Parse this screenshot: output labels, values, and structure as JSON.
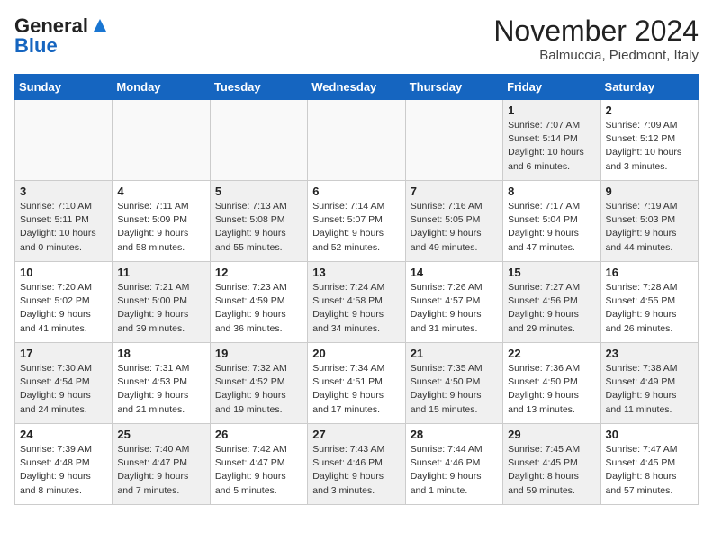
{
  "header": {
    "logo_general": "General",
    "logo_blue": "Blue",
    "month_year": "November 2024",
    "location": "Balmuccia, Piedmont, Italy"
  },
  "days_of_week": [
    "Sunday",
    "Monday",
    "Tuesday",
    "Wednesday",
    "Thursday",
    "Friday",
    "Saturday"
  ],
  "weeks": [
    [
      {
        "day": "",
        "info": "",
        "empty": true
      },
      {
        "day": "",
        "info": "",
        "empty": true
      },
      {
        "day": "",
        "info": "",
        "empty": true
      },
      {
        "day": "",
        "info": "",
        "empty": true
      },
      {
        "day": "",
        "info": "",
        "empty": true
      },
      {
        "day": "1",
        "info": "Sunrise: 7:07 AM\nSunset: 5:14 PM\nDaylight: 10 hours\nand 6 minutes.",
        "shaded": true
      },
      {
        "day": "2",
        "info": "Sunrise: 7:09 AM\nSunset: 5:12 PM\nDaylight: 10 hours\nand 3 minutes.",
        "shaded": false
      }
    ],
    [
      {
        "day": "3",
        "info": "Sunrise: 7:10 AM\nSunset: 5:11 PM\nDaylight: 10 hours\nand 0 minutes.",
        "shaded": true
      },
      {
        "day": "4",
        "info": "Sunrise: 7:11 AM\nSunset: 5:09 PM\nDaylight: 9 hours\nand 58 minutes.",
        "shaded": false
      },
      {
        "day": "5",
        "info": "Sunrise: 7:13 AM\nSunset: 5:08 PM\nDaylight: 9 hours\nand 55 minutes.",
        "shaded": true
      },
      {
        "day": "6",
        "info": "Sunrise: 7:14 AM\nSunset: 5:07 PM\nDaylight: 9 hours\nand 52 minutes.",
        "shaded": false
      },
      {
        "day": "7",
        "info": "Sunrise: 7:16 AM\nSunset: 5:05 PM\nDaylight: 9 hours\nand 49 minutes.",
        "shaded": true
      },
      {
        "day": "8",
        "info": "Sunrise: 7:17 AM\nSunset: 5:04 PM\nDaylight: 9 hours\nand 47 minutes.",
        "shaded": false
      },
      {
        "day": "9",
        "info": "Sunrise: 7:19 AM\nSunset: 5:03 PM\nDaylight: 9 hours\nand 44 minutes.",
        "shaded": true
      }
    ],
    [
      {
        "day": "10",
        "info": "Sunrise: 7:20 AM\nSunset: 5:02 PM\nDaylight: 9 hours\nand 41 minutes.",
        "shaded": false
      },
      {
        "day": "11",
        "info": "Sunrise: 7:21 AM\nSunset: 5:00 PM\nDaylight: 9 hours\nand 39 minutes.",
        "shaded": true
      },
      {
        "day": "12",
        "info": "Sunrise: 7:23 AM\nSunset: 4:59 PM\nDaylight: 9 hours\nand 36 minutes.",
        "shaded": false
      },
      {
        "day": "13",
        "info": "Sunrise: 7:24 AM\nSunset: 4:58 PM\nDaylight: 9 hours\nand 34 minutes.",
        "shaded": true
      },
      {
        "day": "14",
        "info": "Sunrise: 7:26 AM\nSunset: 4:57 PM\nDaylight: 9 hours\nand 31 minutes.",
        "shaded": false
      },
      {
        "day": "15",
        "info": "Sunrise: 7:27 AM\nSunset: 4:56 PM\nDaylight: 9 hours\nand 29 minutes.",
        "shaded": true
      },
      {
        "day": "16",
        "info": "Sunrise: 7:28 AM\nSunset: 4:55 PM\nDaylight: 9 hours\nand 26 minutes.",
        "shaded": false
      }
    ],
    [
      {
        "day": "17",
        "info": "Sunrise: 7:30 AM\nSunset: 4:54 PM\nDaylight: 9 hours\nand 24 minutes.",
        "shaded": true
      },
      {
        "day": "18",
        "info": "Sunrise: 7:31 AM\nSunset: 4:53 PM\nDaylight: 9 hours\nand 21 minutes.",
        "shaded": false
      },
      {
        "day": "19",
        "info": "Sunrise: 7:32 AM\nSunset: 4:52 PM\nDaylight: 9 hours\nand 19 minutes.",
        "shaded": true
      },
      {
        "day": "20",
        "info": "Sunrise: 7:34 AM\nSunset: 4:51 PM\nDaylight: 9 hours\nand 17 minutes.",
        "shaded": false
      },
      {
        "day": "21",
        "info": "Sunrise: 7:35 AM\nSunset: 4:50 PM\nDaylight: 9 hours\nand 15 minutes.",
        "shaded": true
      },
      {
        "day": "22",
        "info": "Sunrise: 7:36 AM\nSunset: 4:50 PM\nDaylight: 9 hours\nand 13 minutes.",
        "shaded": false
      },
      {
        "day": "23",
        "info": "Sunrise: 7:38 AM\nSunset: 4:49 PM\nDaylight: 9 hours\nand 11 minutes.",
        "shaded": true
      }
    ],
    [
      {
        "day": "24",
        "info": "Sunrise: 7:39 AM\nSunset: 4:48 PM\nDaylight: 9 hours\nand 8 minutes.",
        "shaded": false
      },
      {
        "day": "25",
        "info": "Sunrise: 7:40 AM\nSunset: 4:47 PM\nDaylight: 9 hours\nand 7 minutes.",
        "shaded": true
      },
      {
        "day": "26",
        "info": "Sunrise: 7:42 AM\nSunset: 4:47 PM\nDaylight: 9 hours\nand 5 minutes.",
        "shaded": false
      },
      {
        "day": "27",
        "info": "Sunrise: 7:43 AM\nSunset: 4:46 PM\nDaylight: 9 hours\nand 3 minutes.",
        "shaded": true
      },
      {
        "day": "28",
        "info": "Sunrise: 7:44 AM\nSunset: 4:46 PM\nDaylight: 9 hours\nand 1 minute.",
        "shaded": false
      },
      {
        "day": "29",
        "info": "Sunrise: 7:45 AM\nSunset: 4:45 PM\nDaylight: 8 hours\nand 59 minutes.",
        "shaded": true
      },
      {
        "day": "30",
        "info": "Sunrise: 7:47 AM\nSunset: 4:45 PM\nDaylight: 8 hours\nand 57 minutes.",
        "shaded": false
      }
    ]
  ]
}
